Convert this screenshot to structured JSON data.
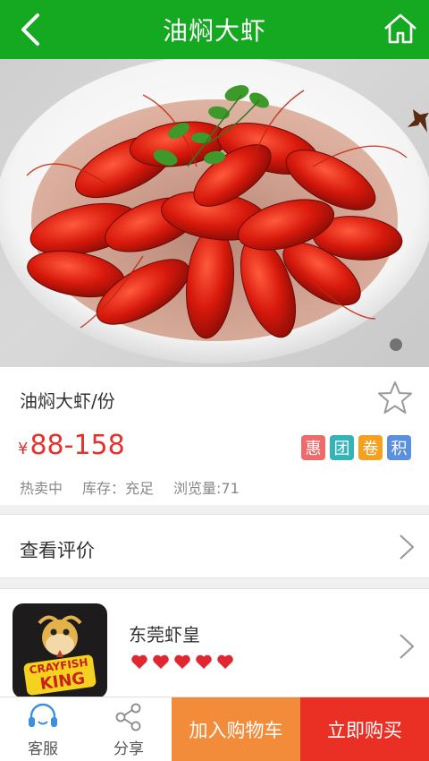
{
  "header": {
    "title": "油焖大虾",
    "back_icon": "chevron-left-icon",
    "home_icon": "home-icon"
  },
  "product": {
    "name": "油焖大虾/份",
    "currency": "¥",
    "price": "88-158",
    "tags": [
      {
        "text": "惠",
        "color": "#ef6b6b"
      },
      {
        "text": "团",
        "color": "#34b3b8"
      },
      {
        "text": "卷",
        "color": "#f4a020"
      },
      {
        "text": "积",
        "color": "#5b8fe0"
      }
    ],
    "meta": {
      "status": "热卖中",
      "stock": "库存：充足",
      "views": "浏览量:71"
    },
    "favorite_icon": "star-outline-icon",
    "image_carousel": {
      "pages": 1,
      "current": 1
    }
  },
  "review": {
    "label": "查看评价"
  },
  "shop": {
    "name": "东莞虾皇",
    "rating": 5,
    "logo_text": [
      "CRAYFISH",
      "KING"
    ]
  },
  "bottom_bar": {
    "service_label": "客服",
    "share_label": "分享",
    "cart_label": "加入购物车",
    "buy_label": "立即购买"
  },
  "colors": {
    "header_green": "#15a821",
    "price_red": "#e8312b",
    "cart_orange": "#f28c3a",
    "buy_red": "#ea2f24",
    "heart_red": "#e0262f"
  }
}
